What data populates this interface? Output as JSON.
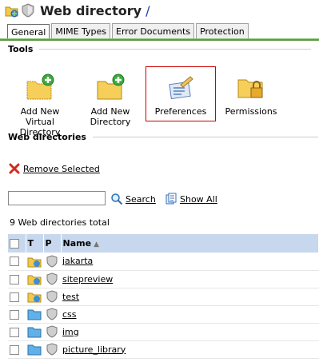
{
  "header": {
    "title": "Web directory",
    "slash": "/"
  },
  "tabs": [
    {
      "label": "General",
      "active": true
    },
    {
      "label": "MIME Types",
      "active": false
    },
    {
      "label": "Error Documents",
      "active": false
    },
    {
      "label": "Protection",
      "active": false
    }
  ],
  "tools": {
    "title": "Tools",
    "items": [
      {
        "label": "Add New Virtual Directory",
        "icon": "folder-add-icon"
      },
      {
        "label": "Add New Directory",
        "icon": "folder-add-icon"
      },
      {
        "label": "Preferences",
        "icon": "preferences-icon",
        "selected": true
      },
      {
        "label": "Permissions",
        "icon": "folder-lock-icon"
      }
    ]
  },
  "webdirs": {
    "title": "Web directories",
    "remove_label": "Remove Selected",
    "search_placeholder": "",
    "search_label": "Search",
    "showall_label": "Show All",
    "total": "9 Web directories total"
  },
  "table": {
    "headers": {
      "t": "T",
      "p": "P",
      "name": "Name",
      "sort_indicator": "▲"
    },
    "rows": [
      {
        "name": "jakarta",
        "type": "virtual"
      },
      {
        "name": "sitepreview",
        "type": "virtual"
      },
      {
        "name": "test",
        "type": "virtual"
      },
      {
        "name": "css",
        "type": "folder"
      },
      {
        "name": "img",
        "type": "folder"
      },
      {
        "name": "picture_library",
        "type": "folder"
      }
    ]
  },
  "colors": {
    "accent_green": "#5a9c45",
    "table_header": "#c7d7ee",
    "link": "#1a3fae",
    "selected_border": "#cc0000"
  }
}
